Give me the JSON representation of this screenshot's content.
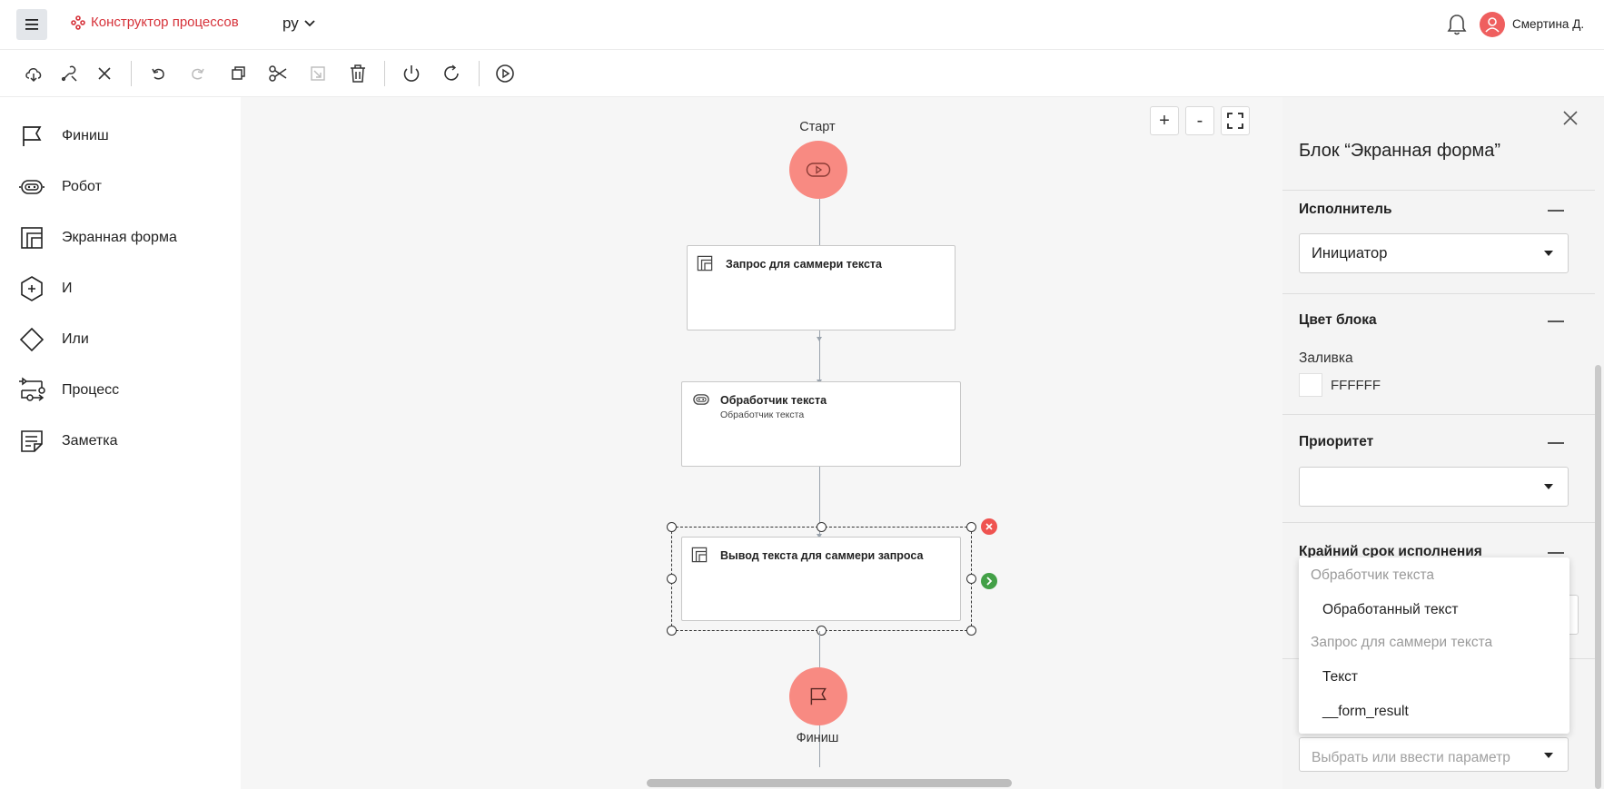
{
  "header": {
    "app_title": "Конструктор процессов",
    "language": "ру",
    "user_name": "Смертина Д."
  },
  "palette": {
    "items": [
      {
        "label": "Финиш",
        "icon": "flag-icon"
      },
      {
        "label": "Робот",
        "icon": "robot-icon"
      },
      {
        "label": "Экранная форма",
        "icon": "screen-form-icon"
      },
      {
        "label": "И",
        "icon": "and-hexagon-icon"
      },
      {
        "label": "Или",
        "icon": "or-diamond-icon"
      },
      {
        "label": "Процесс",
        "icon": "process-icon"
      },
      {
        "label": "Заметка",
        "icon": "note-icon"
      }
    ]
  },
  "canvas": {
    "zoom_in": "+",
    "zoom_out": "-",
    "start_label": "Старт",
    "finish_label": "Финиш",
    "blocks": [
      {
        "title": "Запрос для саммери текста",
        "subtitle": ""
      },
      {
        "title": "Обработчик текста",
        "subtitle": "Обработчик текста"
      },
      {
        "title": "Вывод текста для саммери запроса",
        "subtitle": ""
      }
    ]
  },
  "panel": {
    "title": "Блок “Экранная форма”",
    "executor": {
      "label": "Исполнитель",
      "value": "Инициатор"
    },
    "color": {
      "label": "Цвет блока",
      "fill_label": "Заливка",
      "fill_value": "FFFFFF"
    },
    "priority": {
      "label": "Приоритет",
      "value": ""
    },
    "deadline": {
      "label": "Крайний срок исполнения"
    },
    "param_select": {
      "placeholder": "Выбрать или ввести параметр"
    }
  },
  "dropdown": {
    "groups": [
      {
        "label": "Обработчик текста",
        "items": [
          "Обработанный текст"
        ]
      },
      {
        "label": "Запрос для саммери текста",
        "items": [
          "Текст",
          "__form_result"
        ]
      }
    ]
  },
  "colors": {
    "brand": "#d6323a",
    "node_fill": "#f88a82",
    "delete_badge": "#ef5350",
    "next_badge": "#43a047"
  }
}
